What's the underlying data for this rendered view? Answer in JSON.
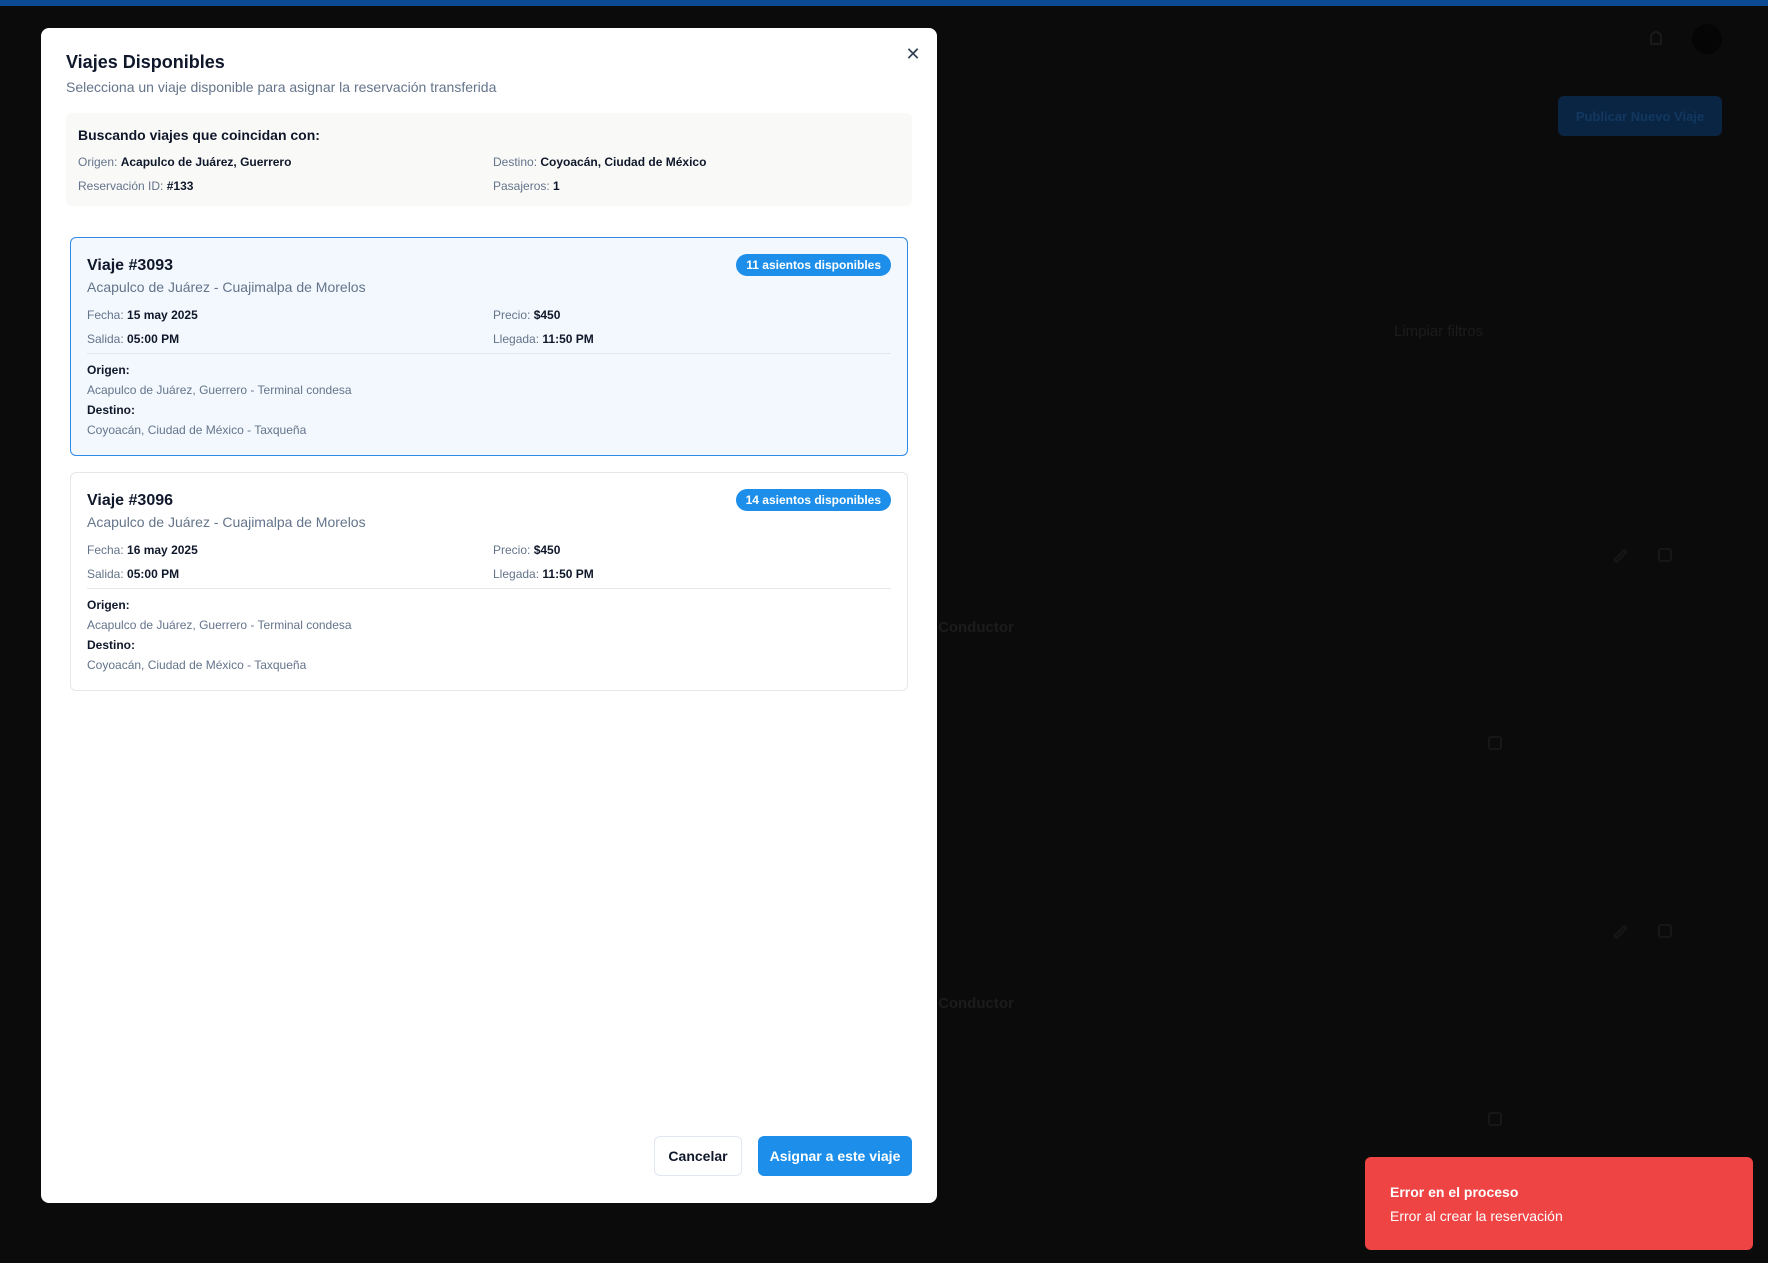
{
  "colors": {
    "accent": "#1d8fea",
    "selected_border": "#2f8be6",
    "selected_bg": "#f2f8fd",
    "toast_error": "#ef4444",
    "overlay": "#0b0b0b",
    "topbar": "#0d4a94"
  },
  "background": {
    "publish_button_label": "Publicar Nuevo Viaje",
    "clear_filters": "Limpiar filtros",
    "driver_label_1": "Conductor",
    "driver_label_2": "Conductor"
  },
  "modal": {
    "title": "Viajes Disponibles",
    "subtitle": "Selecciona un viaje disponible para asignar la reservación transferida",
    "close_icon": "close-icon",
    "close_glyph": "✕",
    "search": {
      "heading": "Buscando viajes que coincidan con:",
      "origin_label": "Origen:",
      "origin_value": "Acapulco de Juárez, Guerrero",
      "destination_label": "Destino:",
      "destination_value": "Coyoacán, Ciudad de México",
      "reservation_label": "Reservación ID:",
      "reservation_value": "#133",
      "passengers_label": "Pasajeros:",
      "passengers_value": "1"
    },
    "trips": [
      {
        "title": "Viaje #3093",
        "route": "Acapulco de Juárez - Cuajimalpa de Morelos",
        "badge": "11 asientos disponibles",
        "date_label": "Fecha:",
        "date_value": "15 may 2025",
        "price_label": "Precio:",
        "price_value": "$450",
        "departure_label": "Salida:",
        "departure_value": "05:00 PM",
        "arrival_label": "Llegada:",
        "arrival_value": "11:50 PM",
        "origin_label": "Origen:",
        "origin_value": "Acapulco de Juárez, Guerrero - Terminal condesa",
        "destination_label": "Destino:",
        "destination_value": "Coyoacán, Ciudad de México - Taxqueña",
        "selected": true
      },
      {
        "title": "Viaje #3096",
        "route": "Acapulco de Juárez - Cuajimalpa de Morelos",
        "badge": "14 asientos disponibles",
        "date_label": "Fecha:",
        "date_value": "16 may 2025",
        "price_label": "Precio:",
        "price_value": "$450",
        "departure_label": "Salida:",
        "departure_value": "05:00 PM",
        "arrival_label": "Llegada:",
        "arrival_value": "11:50 PM",
        "origin_label": "Origen:",
        "origin_value": "Acapulco de Juárez, Guerrero - Terminal condesa",
        "destination_label": "Destino:",
        "destination_value": "Coyoacán, Ciudad de México - Taxqueña",
        "selected": false
      }
    ],
    "cancel_label": "Cancelar",
    "assign_label": "Asignar a este viaje"
  },
  "toast": {
    "title": "Error en el proceso",
    "message": "Error al crear la reservación"
  }
}
